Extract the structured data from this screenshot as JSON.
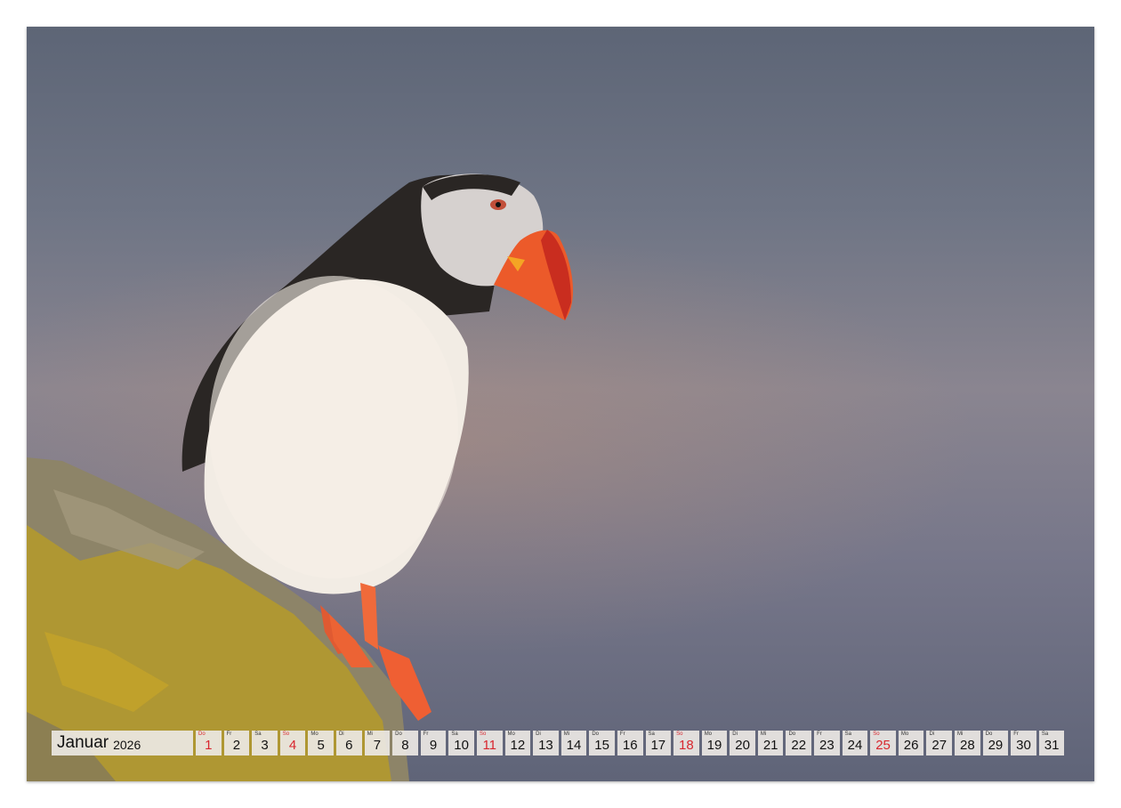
{
  "calendar": {
    "month": "Januar",
    "year": "2026",
    "days": [
      {
        "dow": "Do",
        "num": "1",
        "sunday": true
      },
      {
        "dow": "Fr",
        "num": "2"
      },
      {
        "dow": "Sa",
        "num": "3"
      },
      {
        "dow": "So",
        "num": "4",
        "sunday": true
      },
      {
        "dow": "Mo",
        "num": "5"
      },
      {
        "dow": "Di",
        "num": "6"
      },
      {
        "dow": "Mi",
        "num": "7"
      },
      {
        "dow": "Do",
        "num": "8"
      },
      {
        "dow": "Fr",
        "num": "9"
      },
      {
        "dow": "Sa",
        "num": "10"
      },
      {
        "dow": "So",
        "num": "11",
        "sunday": true
      },
      {
        "dow": "Mo",
        "num": "12"
      },
      {
        "dow": "Di",
        "num": "13"
      },
      {
        "dow": "Mi",
        "num": "14"
      },
      {
        "dow": "Do",
        "num": "15"
      },
      {
        "dow": "Fr",
        "num": "16"
      },
      {
        "dow": "Sa",
        "num": "17"
      },
      {
        "dow": "So",
        "num": "18",
        "sunday": true
      },
      {
        "dow": "Mo",
        "num": "19"
      },
      {
        "dow": "Di",
        "num": "20"
      },
      {
        "dow": "Mi",
        "num": "21"
      },
      {
        "dow": "Do",
        "num": "22"
      },
      {
        "dow": "Fr",
        "num": "23"
      },
      {
        "dow": "Sa",
        "num": "24"
      },
      {
        "dow": "So",
        "num": "25",
        "sunday": true
      },
      {
        "dow": "Mo",
        "num": "26"
      },
      {
        "dow": "Di",
        "num": "27"
      },
      {
        "dow": "Mi",
        "num": "28"
      },
      {
        "dow": "Do",
        "num": "29"
      },
      {
        "dow": "Fr",
        "num": "30"
      },
      {
        "dow": "Sa",
        "num": "31"
      }
    ]
  },
  "colors": {
    "holiday_red": "#d8262e",
    "cell_background": "#ece8e4",
    "sky_blue_gray": "#6f7585"
  },
  "photo": {
    "subject_icon": "puffin-on-rock-photo"
  }
}
